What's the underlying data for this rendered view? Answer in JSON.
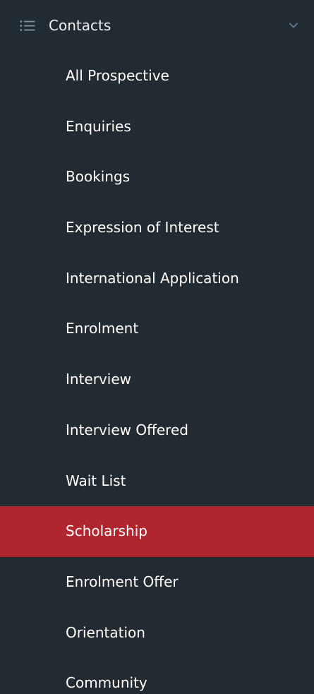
{
  "colors": {
    "background": "#222a32",
    "active_item": "#b0262f",
    "text": "#ffffff",
    "icon": "#8a96a3"
  },
  "section": {
    "icon": "list-icon",
    "label": "Contacts",
    "toggle_icon": "chevron-down-icon",
    "expanded": true
  },
  "items": [
    {
      "label": "All Prospective",
      "active": false
    },
    {
      "label": "Enquiries",
      "active": false
    },
    {
      "label": "Bookings",
      "active": false
    },
    {
      "label": "Expression of Interest",
      "active": false
    },
    {
      "label": "International Application",
      "active": false
    },
    {
      "label": "Enrolment",
      "active": false
    },
    {
      "label": "Interview",
      "active": false
    },
    {
      "label": "Interview Offered",
      "active": false
    },
    {
      "label": "Wait List",
      "active": false
    },
    {
      "label": "Scholarship",
      "active": true
    },
    {
      "label": "Enrolment Offer",
      "active": false
    },
    {
      "label": "Orientation",
      "active": false
    },
    {
      "label": "Community",
      "active": false
    }
  ]
}
